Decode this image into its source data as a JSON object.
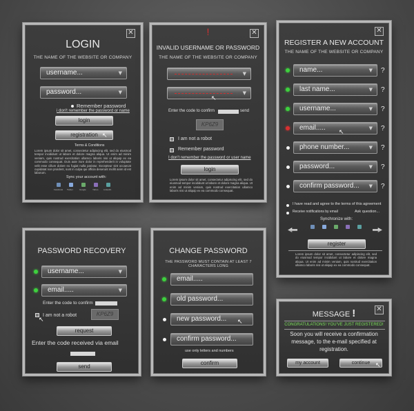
{
  "colors": {
    "accent_green": "#3ed13e",
    "error_red": "#d83030",
    "success_green": "#7be05a"
  },
  "login": {
    "title": "LOGIN",
    "subtitle": "THE NAME OF THE WEBSITE OR COMPANY",
    "username_placeholder": "username...",
    "password_placeholder": "password...",
    "remember": "Remember password",
    "forgot": "i don't remember the password or name",
    "login_btn": "login",
    "register_btn": "registration",
    "terms": "Terms & Conditions",
    "body": "Lorem ipsum dolor sit amet, consectetur adipiscing elit, sed do eiusmod tempor incididunt ut labore et dolore magna aliqua. Ut enim ad minim veniam, quis nostrud exercitation ullamco laboris nisi ut aliquip ex ea commodo consequat. Duis aute irure dolor in reprehenderit in voluptate velit esse cillum dolore eu fugiat nulla pariatur. Excepteur sint occaecat cupidatat non proident, sunt in culpa qui officia deserunt mollit anim id est laborum.",
    "sync": "Sync your account with:",
    "social": [
      "Facebook",
      "Twitter",
      "Google",
      "Yahoo",
      "LinkedIn"
    ]
  },
  "invalid": {
    "title": "INVALID USERNAME OR PASSWORD",
    "mark": "!",
    "subtitle": "THE NAME OF THE WEBSITE OR COMPANY",
    "code_label": "Enter the code to confirm",
    "send": "send",
    "captcha": "KP6Z9",
    "robot": "I am not a robot",
    "remember": "Remember password",
    "forgot": "I don't remember the password or user name",
    "login_btn": "login",
    "body": "Lorem ipsum dolor sit amet, consectetur adipiscing elit, sed do eiusmod tempor incididunt ut labore et dolore magna aliqua. Ut enim ad minim veniam, quis nostrud exercitation ullamco laboris nisi ut aliquip ex ea commodo consequat."
  },
  "register": {
    "title": "REGISTER A NEW ACCOUNT",
    "subtitle": "THE NAME OF THE WEBSITE OR COMPANY",
    "fields": [
      "name...",
      "last name...",
      "username...",
      "email.....",
      "phone number...",
      "password...",
      "confirm password..."
    ],
    "agree": "I have read and agree to the terms of this agreement",
    "notify": "Receive notifications by email",
    "ask": "Ask question...",
    "sync": "Synchronize with:",
    "register_btn": "register",
    "body": "Lorem ipsum dolor sit amet, consectetur adipiscing elit, sed do eiusmod tempor incididunt ut labore et dolore magna aliqua. Ut enim ad minim veniam, quis nostrud exercitation ullamco laboris nisi ut aliquip ex ea commodo consequat."
  },
  "recovery": {
    "title": "PASSWORD RECOVERY",
    "username_placeholder": "username...",
    "email_placeholder": "email.....",
    "code_label": "Enter the code to confirm",
    "captcha": "KP6Z9",
    "robot": "I am not a robot",
    "request_btn": "request",
    "code_via_email": "Enter the code received via email",
    "send_btn": "send"
  },
  "change": {
    "title": "CHANGE PASSWORD",
    "subtitle": "THE PASSWORD MUST CONTAIN AT LEAST 7 CHARACTERS LONG",
    "email_placeholder": "email.....",
    "old_placeholder": "old password...",
    "new_placeholder": "new password...",
    "confirm_placeholder": "confirm password...",
    "hint": "use only letters and numbers",
    "confirm_btn": "confirm"
  },
  "message": {
    "title": "MESSAGE",
    "mark": "!",
    "congrats": "CONGRATULATIONS! YOU'VE JUST REGISTERED!",
    "line1": "Soon you will receive a confirmation",
    "line2": "message, to the e-mail specified at",
    "line3": "registration.",
    "myaccount_btn": "my account",
    "continue_btn": "continue"
  }
}
